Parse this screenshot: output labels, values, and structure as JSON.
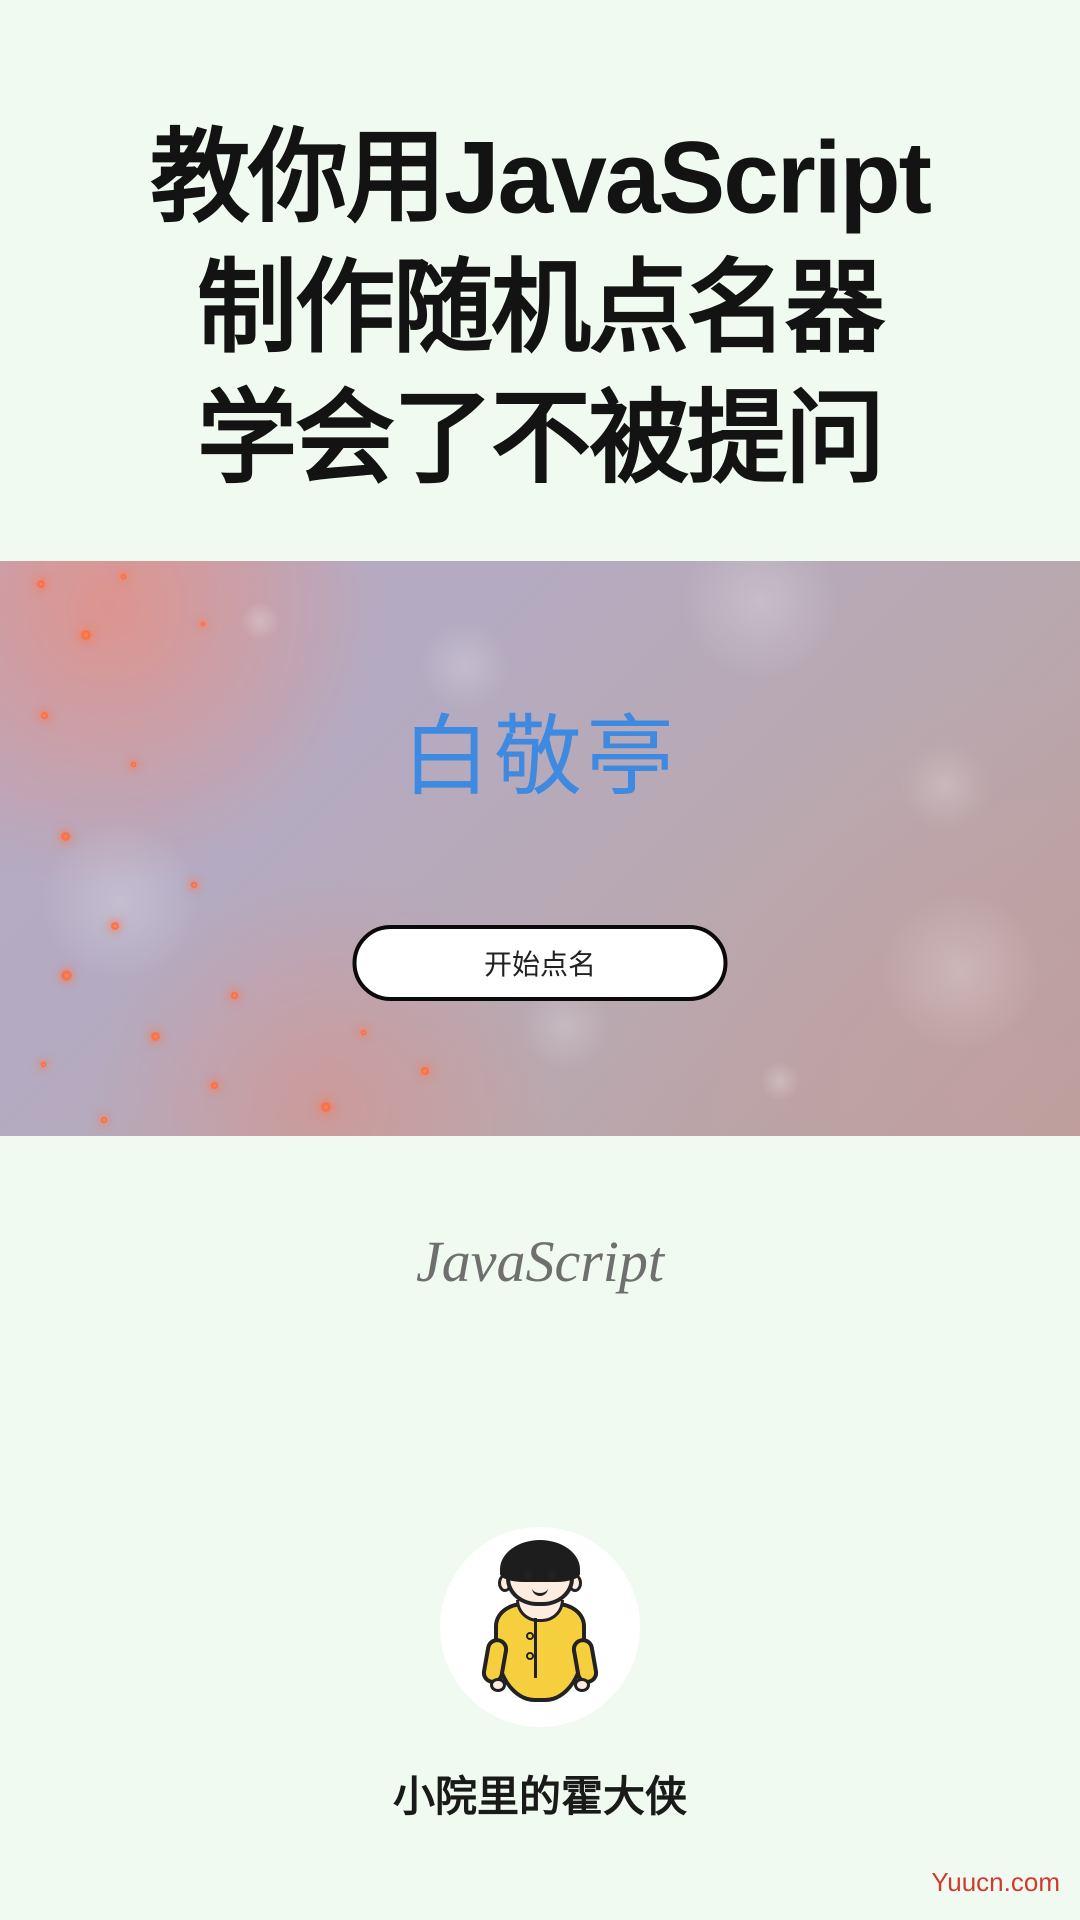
{
  "title": {
    "line1": "教你用JavaScript",
    "line2": "制作随机点名器",
    "line3": "学会了不被提问"
  },
  "demo": {
    "picked_name": "白敬亭",
    "start_button_label": "开始点名"
  },
  "sub_label": "JavaScript",
  "author": {
    "name": "小院里的霍大侠"
  },
  "watermark": "Yuucn.com",
  "colors": {
    "page_bg": "#f0faf0",
    "title_text": "#131313",
    "picked_name_text": "#3e8ae0",
    "button_bg": "#ffffff",
    "button_border": "#0a0a0a",
    "sub_label_text": "#6f6f6f",
    "watermark_text": "#d33a2f",
    "avatar_robe": "#f6cf3f"
  }
}
